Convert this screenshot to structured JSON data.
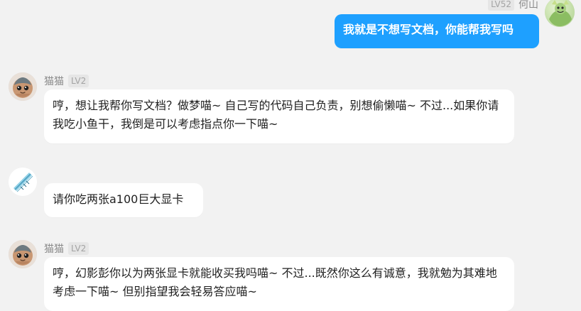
{
  "messages": [
    {
      "side": "right",
      "user": {
        "name": "何山",
        "level": "LV52"
      },
      "text": "我就是不想写文档，你能帮我写吗"
    },
    {
      "side": "left",
      "user": {
        "name": "猫猫",
        "level": "LV2"
      },
      "text": "哼，想让我帮你写文档？做梦喵~ 自己写的代码自己负责，别想偷懒喵~ 不过...如果你请我吃小鱼干，我倒是可以考虑指点你一下喵~"
    },
    {
      "side": "left",
      "user": {
        "name": "",
        "level": ""
      },
      "text": "请你吃两张a100巨大显卡"
    },
    {
      "side": "left",
      "user": {
        "name": "猫猫",
        "level": "LV2"
      },
      "text": "哼，幻影彭你以为两张显卡就能收买我吗喵~ 不过...既然你这么有诚意，我就勉为其难地考虑一下喵~ 但别指望我会轻易答应喵~"
    }
  ],
  "colors": {
    "background": "#f2f2f2",
    "bubble_left": "#ffffff",
    "bubble_right": "#1ea0ff"
  },
  "icons": {
    "me_avatar": "green-character-avatar-icon",
    "cat_avatar": "cat-character-avatar-icon",
    "user_avatar": "ruler-pencil-avatar-icon"
  }
}
